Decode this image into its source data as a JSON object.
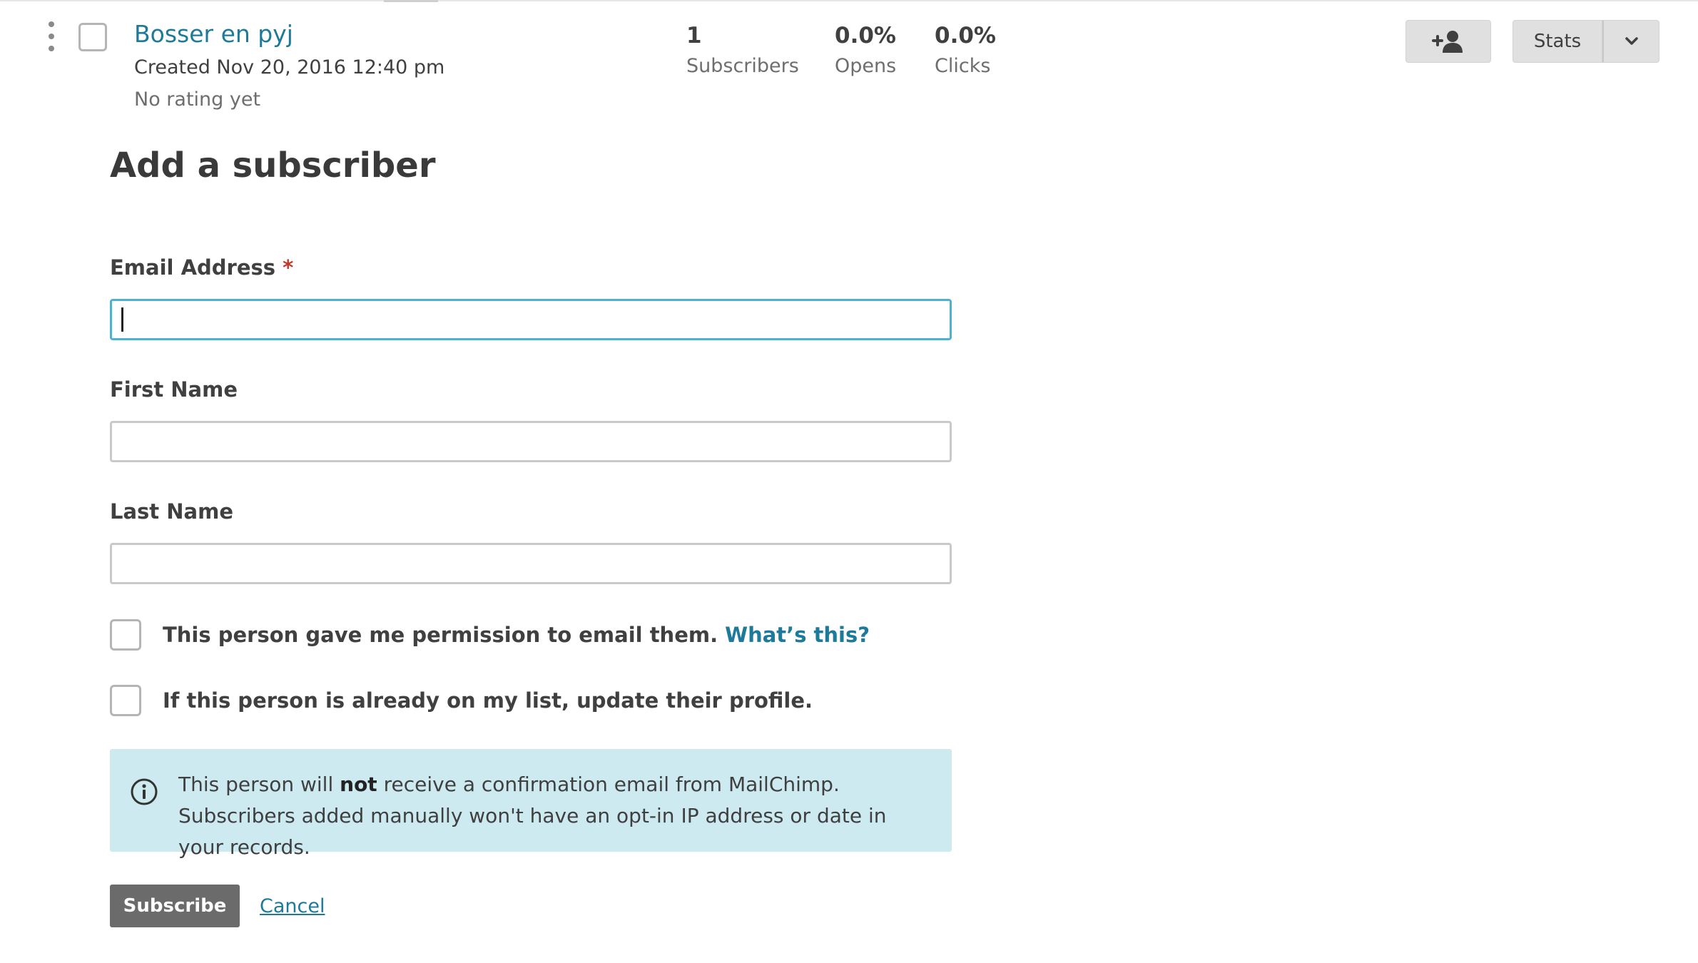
{
  "list_row": {
    "name": "Bosser en pyj",
    "created": "Created Nov 20, 2016 12:40 pm",
    "rating": "No rating yet",
    "stats": {
      "subscribers_value": "1",
      "subscribers_label": "Subscribers",
      "opens_value": "0.0%",
      "opens_label": "Opens",
      "clicks_value": "0.0%",
      "clicks_label": "Clicks"
    },
    "actions": {
      "add_subscriber_icon": "add-person-icon",
      "stats_label": "Stats",
      "dropdown_icon": "chevron-down-icon"
    }
  },
  "form": {
    "title": "Add a subscriber",
    "email_label": "Email Address",
    "required_marker": "*",
    "email_value": "",
    "first_name_label": "First Name",
    "first_name_value": "",
    "last_name_label": "Last Name",
    "last_name_value": "",
    "permission_text": "This person gave me permission to email them.",
    "permission_link": "What’s this?",
    "permission_checked": false,
    "update_text": "If this person is already on my list, update their profile.",
    "update_checked": false,
    "notice": {
      "icon": "info-icon",
      "before_bold": "This person will ",
      "bold": "not",
      "after_bold": " receive a confirmation email from MailChimp. Subscribers added manually won't have an opt-in IP address or date in your records."
    },
    "subscribe_label": "Subscribe",
    "cancel_label": "Cancel"
  },
  "colors": {
    "link": "#1e7a9a",
    "focus_border": "#4ab3cf",
    "notice_bg": "#cdeaf1",
    "required": "#c0392b",
    "primary_button": "#6b6b6b"
  }
}
